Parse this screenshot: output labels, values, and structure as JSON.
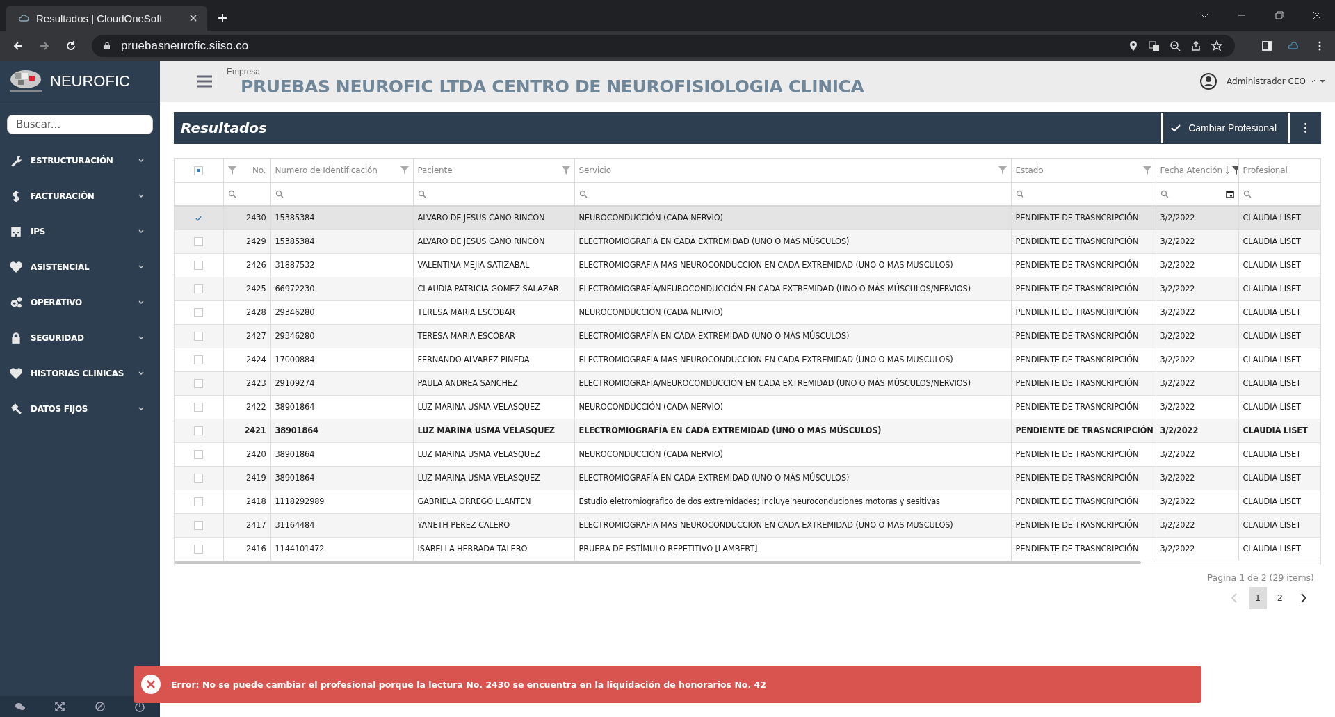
{
  "browser": {
    "tab_title": "Resultados | CloudOneSoft",
    "url": "pruebasneurofic.siiso.co"
  },
  "sidebar": {
    "brand": "NEUROFIC",
    "search_placeholder": "Buscar...",
    "items": [
      {
        "label": "ESTRUCTURACIÓN"
      },
      {
        "label": "FACTURACIÓN"
      },
      {
        "label": "IPS"
      },
      {
        "label": "ASISTENCIAL"
      },
      {
        "label": "OPERATIVO"
      },
      {
        "label": "SEGURIDAD"
      },
      {
        "label": "HISTORIAS CLINICAS"
      },
      {
        "label": "DATOS FIJOS"
      }
    ]
  },
  "header": {
    "company_label": "Empresa",
    "company_name": "PRUEBAS NEUROFIC LTDA CENTRO DE NEUROFISIOLOGIA CLINICA",
    "user": "Administrador CEO"
  },
  "panel": {
    "title": "Resultados",
    "action_button": "Cambiar Profesional"
  },
  "table": {
    "header_checkbox": {
      "indeterminate": true
    },
    "columns": [
      {
        "label": "No.",
        "filter": true,
        "sorted": false
      },
      {
        "label": "Numero de Identificación",
        "filter": true,
        "sorted": false
      },
      {
        "label": "Paciente",
        "filter": true,
        "sorted": false
      },
      {
        "label": "Servicio",
        "filter": true,
        "sorted": false
      },
      {
        "label": "Estado",
        "filter": true,
        "sorted": false
      },
      {
        "label": "Fecha Atención",
        "filter": true,
        "sorted": true
      },
      {
        "label": "Profesional",
        "filter": false,
        "sorted": false
      }
    ],
    "rows": [
      {
        "selected": true,
        "bold": false,
        "cells": [
          "2430",
          "15385384",
          "ALVARO DE JESUS CANO RINCON",
          "NEUROCONDUCCIÓN (CADA NERVIO)",
          "PENDIENTE DE TRASNCRIPCIÓN",
          "3/2/2022",
          "CLAUDIA LISET"
        ]
      },
      {
        "selected": false,
        "bold": false,
        "cells": [
          "2429",
          "15385384",
          "ALVARO DE JESUS CANO RINCON",
          "ELECTROMIOGRAFÍA EN CADA EXTREMIDAD (UNO O MÁS MÚSCULOS)",
          "PENDIENTE DE TRASNCRIPCIÓN",
          "3/2/2022",
          "CLAUDIA LISET"
        ]
      },
      {
        "selected": false,
        "bold": false,
        "cells": [
          "2426",
          "31887532",
          "VALENTINA MEJIA SATIZABAL",
          "ELECTROMIOGRAFIA MAS NEUROCONDUCCION EN CADA EXTREMIDAD (UNO O MAS MUSCULOS)",
          "PENDIENTE DE TRASNCRIPCIÓN",
          "3/2/2022",
          "CLAUDIA LISET"
        ]
      },
      {
        "selected": false,
        "bold": false,
        "cells": [
          "2425",
          "66972230",
          "CLAUDIA PATRICIA GOMEZ SALAZAR",
          "ELECTROMIOGRAFÍA/NEUROCONDUCCIÓN EN CADA EXTREMIDAD (UNO O MÁS MÚSCULOS/NERVIOS)",
          "PENDIENTE DE TRASNCRIPCIÓN",
          "3/2/2022",
          "CLAUDIA LISET"
        ]
      },
      {
        "selected": false,
        "bold": false,
        "cells": [
          "2428",
          "29346280",
          "TERESA MARIA ESCOBAR",
          "NEUROCONDUCCIÓN (CADA NERVIO)",
          "PENDIENTE DE TRASNCRIPCIÓN",
          "3/2/2022",
          "CLAUDIA LISET"
        ]
      },
      {
        "selected": false,
        "bold": false,
        "cells": [
          "2427",
          "29346280",
          "TERESA MARIA ESCOBAR",
          "ELECTROMIOGRAFÍA EN CADA EXTREMIDAD (UNO O MÁS MÚSCULOS)",
          "PENDIENTE DE TRASNCRIPCIÓN",
          "3/2/2022",
          "CLAUDIA LISET"
        ]
      },
      {
        "selected": false,
        "bold": false,
        "cells": [
          "2424",
          "17000884",
          "FERNANDO ALVAREZ PINEDA",
          "ELECTROMIOGRAFIA MAS NEUROCONDUCCION EN CADA EXTREMIDAD (UNO O MAS MUSCULOS)",
          "PENDIENTE DE TRASNCRIPCIÓN",
          "3/2/2022",
          "CLAUDIA LISET"
        ]
      },
      {
        "selected": false,
        "bold": false,
        "cells": [
          "2423",
          "29109274",
          "PAULA ANDREA SANCHEZ",
          "ELECTROMIOGRAFÍA/NEUROCONDUCCIÓN EN CADA EXTREMIDAD (UNO O MÁS MÚSCULOS/NERVIOS)",
          "PENDIENTE DE TRASNCRIPCIÓN",
          "3/2/2022",
          "CLAUDIA LISET"
        ]
      },
      {
        "selected": false,
        "bold": false,
        "cells": [
          "2422",
          "38901864",
          "LUZ MARINA USMA VELASQUEZ",
          "NEUROCONDUCCIÓN (CADA NERVIO)",
          "PENDIENTE DE TRASNCRIPCIÓN",
          "3/2/2022",
          "CLAUDIA LISET"
        ]
      },
      {
        "selected": false,
        "bold": true,
        "cells": [
          "2421",
          "38901864",
          "LUZ MARINA USMA VELASQUEZ",
          "ELECTROMIOGRAFÍA EN CADA EXTREMIDAD (UNO O MÁS MÚSCULOS)",
          "PENDIENTE DE TRASNCRIPCIÓN",
          "3/2/2022",
          "CLAUDIA LISET"
        ]
      },
      {
        "selected": false,
        "bold": false,
        "cells": [
          "2420",
          "38901864",
          "LUZ MARINA USMA VELASQUEZ",
          "NEUROCONDUCCIÓN (CADA NERVIO)",
          "PENDIENTE DE TRASNCRIPCIÓN",
          "3/2/2022",
          "CLAUDIA LISET"
        ]
      },
      {
        "selected": false,
        "bold": false,
        "cells": [
          "2419",
          "38901864",
          "LUZ MARINA USMA VELASQUEZ",
          "ELECTROMIOGRAFÍA EN CADA EXTREMIDAD (UNO O MÁS MÚSCULOS)",
          "PENDIENTE DE TRASNCRIPCIÓN",
          "3/2/2022",
          "CLAUDIA LISET"
        ]
      },
      {
        "selected": false,
        "bold": false,
        "cells": [
          "2418",
          "1118292989",
          "GABRIELA ORREGO LLANTEN",
          "Estudio eletromiografico de dos extremidades; incluye neuroconduciones motoras y sesitivas",
          "PENDIENTE DE TRASNCRIPCIÓN",
          "3/2/2022",
          "CLAUDIA LISET"
        ]
      },
      {
        "selected": false,
        "bold": false,
        "cells": [
          "2417",
          "31164484",
          "YANETH PEREZ CALERO",
          "ELECTROMIOGRAFIA MAS NEUROCONDUCCION EN CADA EXTREMIDAD (UNO O MAS MUSCULOS)",
          "PENDIENTE DE TRASNCRIPCIÓN",
          "3/2/2022",
          "CLAUDIA LISET"
        ]
      },
      {
        "selected": false,
        "bold": false,
        "cells": [
          "2416",
          "1144101472",
          "ISABELLA HERRADA TALERO",
          "PRUEBA DE ESTÍMULO REPETITIVO [LAMBERT]",
          "PENDIENTE DE TRASNCRIPCIÓN",
          "3/2/2022",
          "CLAUDIA LISET"
        ]
      }
    ]
  },
  "pagination": {
    "summary": "Página 1 de 2 (29 items)",
    "pages": [
      {
        "label": "1",
        "selected": true
      },
      {
        "label": "2",
        "selected": false
      }
    ]
  },
  "error": {
    "message": "Error: No se puede cambiar el profesional porque la lectura No. 2430 se encuentra en la liquidación de honorarios No. 42"
  }
}
